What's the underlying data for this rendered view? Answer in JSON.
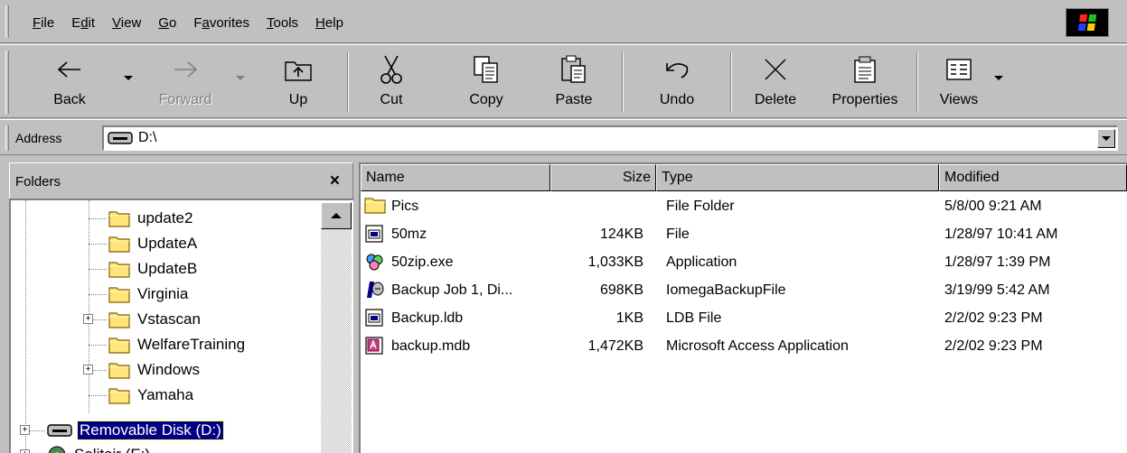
{
  "menu": [
    "File",
    "Edit",
    "View",
    "Go",
    "Favorites",
    "Tools",
    "Help"
  ],
  "menu_mnemonics": [
    "F",
    "d",
    "V",
    "G",
    "a",
    "T",
    "H"
  ],
  "toolbar": {
    "back": "Back",
    "forward": "Forward",
    "up": "Up",
    "cut": "Cut",
    "copy": "Copy",
    "paste": "Paste",
    "undo": "Undo",
    "delete": "Delete",
    "properties": "Properties",
    "views": "Views"
  },
  "address": {
    "label": "Address",
    "value": "D:\\"
  },
  "folders": {
    "title": "Folders",
    "close": "×",
    "items": [
      {
        "label": "update2",
        "expandable": false
      },
      {
        "label": "UpdateA",
        "expandable": false
      },
      {
        "label": "UpdateB",
        "expandable": false
      },
      {
        "label": "Virginia",
        "expandable": false
      },
      {
        "label": "Vstascan",
        "expandable": true
      },
      {
        "label": "WelfareTraining",
        "expandable": false
      },
      {
        "label": "Windows",
        "expandable": true
      },
      {
        "label": "Yamaha",
        "expandable": false
      }
    ],
    "selected_drive": "Removable Disk (D:)",
    "next_drive": "Solitair (E:)"
  },
  "columns": {
    "name": "Name",
    "size": "Size",
    "type": "Type",
    "modified": "Modified"
  },
  "files": [
    {
      "name": "Pics",
      "size": "",
      "type": "File Folder",
      "modified": "5/8/00 9:21 AM",
      "icon": "folder-icon"
    },
    {
      "name": "50mz",
      "size": "124KB",
      "type": "File",
      "modified": "1/28/97 10:41 AM",
      "icon": "file-icon"
    },
    {
      "name": "50zip.exe",
      "size": "1,033KB",
      "type": "Application",
      "modified": "1/28/97 1:39 PM",
      "icon": "application-icon"
    },
    {
      "name": "Backup Job 1, Di...",
      "size": "698KB",
      "type": "IomegaBackupFile",
      "modified": "3/19/99 5:42 AM",
      "icon": "backup-job-icon"
    },
    {
      "name": "Backup.ldb",
      "size": "1KB",
      "type": "LDB File",
      "modified": "2/2/02 9:23 PM",
      "icon": "file-icon"
    },
    {
      "name": "backup.mdb",
      "size": "1,472KB",
      "type": "Microsoft Access Application",
      "modified": "2/2/02 9:23 PM",
      "icon": "access-database-icon"
    }
  ]
}
